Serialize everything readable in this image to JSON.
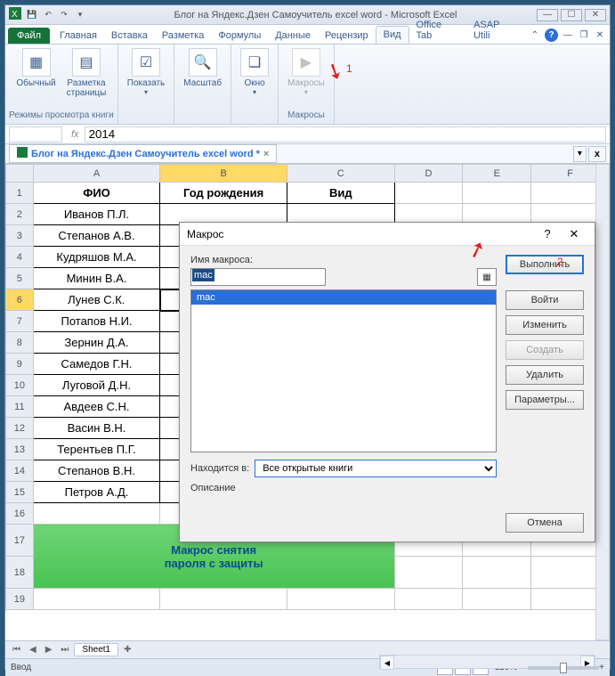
{
  "titlebar": {
    "title": "Блог на Яндекс.Дзен Самоучитель excel word  -  Microsoft Excel"
  },
  "tabs": {
    "file": "Файл",
    "items": [
      "Главная",
      "Вставка",
      "Разметка",
      "Формулы",
      "Данные",
      "Рецензир",
      "Вид",
      "Office Tab",
      "ASAP Utili"
    ],
    "active_index": 6
  },
  "ribbon": {
    "group1_label": "Режимы просмотра книги",
    "btn_normal": "Обычный",
    "btn_layout": "Разметка\nстраницы",
    "group2_btn": "Показать",
    "group3_btn": "Масштаб",
    "group4_btn": "Окно",
    "group5_btn": "Макросы",
    "group5_label": "Макросы"
  },
  "formula_bar": {
    "name_box": "",
    "value": "2014"
  },
  "doc_tab": {
    "label": "Блог на Яндекс.Дзен Самоучитель excel word *"
  },
  "columns": [
    "A",
    "B",
    "C",
    "D",
    "E",
    "F"
  ],
  "headers": {
    "A": "ФИО",
    "B": "Год рождения",
    "C": "Вид"
  },
  "rows": [
    "Иванов П.Л.",
    "Степанов А.В.",
    "Кудряшов М.А.",
    "Минин В.А.",
    "Лунев С.К.",
    "Потапов Н.И.",
    "Зернин Д.А.",
    "Самедов Г.Н.",
    "Луговой Д.Н.",
    "Авдеев С.Н.",
    "Васин В.Н.",
    "Терентьев П.Г.",
    "Степанов В.Н.",
    "Петров А.Д."
  ],
  "green_box_l1": "Макрос снятия",
  "green_box_l2": "пароля с защиты",
  "dialog": {
    "title": "Макрос",
    "name_label": "Имя макроса:",
    "name_value": "mac",
    "list_item": "mac",
    "located_label": "Находится в:",
    "located_value": "Все открытые книги",
    "desc_label": "Описание",
    "btn_run": "Выполнить",
    "btn_step": "Войти",
    "btn_edit": "Изменить",
    "btn_create": "Создать",
    "btn_delete": "Удалить",
    "btn_params": "Параметры...",
    "btn_cancel": "Отмена"
  },
  "marks": {
    "m1": "1",
    "m2": "2"
  },
  "sheet_tabs": {
    "sheet1": "Sheet1"
  },
  "statusbar": {
    "ready": "Ввод",
    "zoom": "120%"
  }
}
